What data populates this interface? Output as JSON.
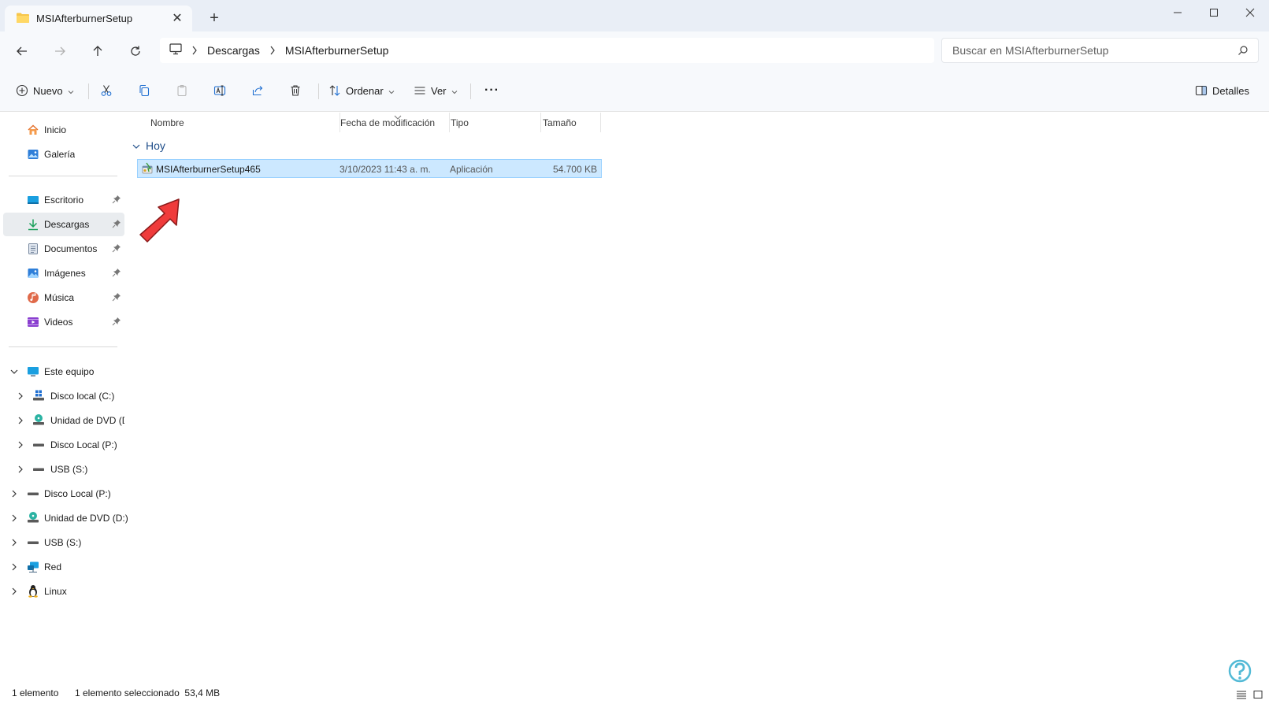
{
  "window": {
    "tab_title": "MSIAfterburnerSetup",
    "close_tab_glyph": "✕",
    "new_tab_glyph": "+"
  },
  "address": {
    "crumbs": [
      "Descargas",
      "MSIAfterburnerSetup"
    ],
    "root_icon": "computer-icon"
  },
  "search": {
    "placeholder": "Buscar en MSIAfterburnerSetup"
  },
  "toolbar": {
    "new_label": "Nuevo",
    "sort_label": "Ordenar",
    "view_label": "Ver",
    "more_label": "···",
    "details_label": "Detalles"
  },
  "sidebar": {
    "top": [
      {
        "label": "Inicio",
        "icon": "home-icon"
      },
      {
        "label": "Galería",
        "icon": "gallery-icon"
      }
    ],
    "pinned": [
      {
        "label": "Escritorio",
        "icon": "desktop-icon",
        "color": "#1a9fe0"
      },
      {
        "label": "Descargas",
        "icon": "download-icon",
        "color": "#1aa05a"
      },
      {
        "label": "Documentos",
        "icon": "documents-icon",
        "color": "#7a8aa0"
      },
      {
        "label": "Imágenes",
        "icon": "pictures-icon",
        "color": "#2f7fd9"
      },
      {
        "label": "Música",
        "icon": "music-icon",
        "color": "#e06a4a"
      },
      {
        "label": "Videos",
        "icon": "videos-icon",
        "color": "#8a3fcf"
      }
    ],
    "this_pc": {
      "label": "Este equipo",
      "children": [
        {
          "label": "Disco local (C:)",
          "icon": "windows-drive-icon"
        },
        {
          "label": "Unidad de DVD (D:)",
          "icon": "dvd-drive-icon"
        },
        {
          "label": "Disco Local (P:)",
          "icon": "drive-icon"
        },
        {
          "label": "USB (S:)",
          "icon": "usb-drive-icon"
        }
      ]
    },
    "root": [
      {
        "label": "Disco Local (P:)",
        "icon": "drive-icon"
      },
      {
        "label": "Unidad de DVD (D:)",
        "icon": "dvd-drive-icon"
      },
      {
        "label": "USB (S:)",
        "icon": "usb-drive-icon"
      },
      {
        "label": "Red",
        "icon": "network-icon"
      },
      {
        "label": "Linux",
        "icon": "linux-icon"
      }
    ]
  },
  "columns": {
    "name": "Nombre",
    "modified": "Fecha de modificación",
    "type": "Tipo",
    "size": "Tamaño"
  },
  "group": {
    "label": "Hoy"
  },
  "files": [
    {
      "name": "MSIAfterburnerSetup465",
      "modified": "3/10/2023 11:43 a. m.",
      "type": "Aplicación",
      "size": "54.700 KB",
      "selected": true
    }
  ],
  "status": {
    "count": "1 elemento",
    "selection": "1 elemento seleccionado  53,4 MB"
  },
  "colors": {
    "accent": "#0067c0",
    "selection_bg": "#cce8ff",
    "selection_border": "#99d1ff",
    "arrow": "#ef3b3b"
  }
}
